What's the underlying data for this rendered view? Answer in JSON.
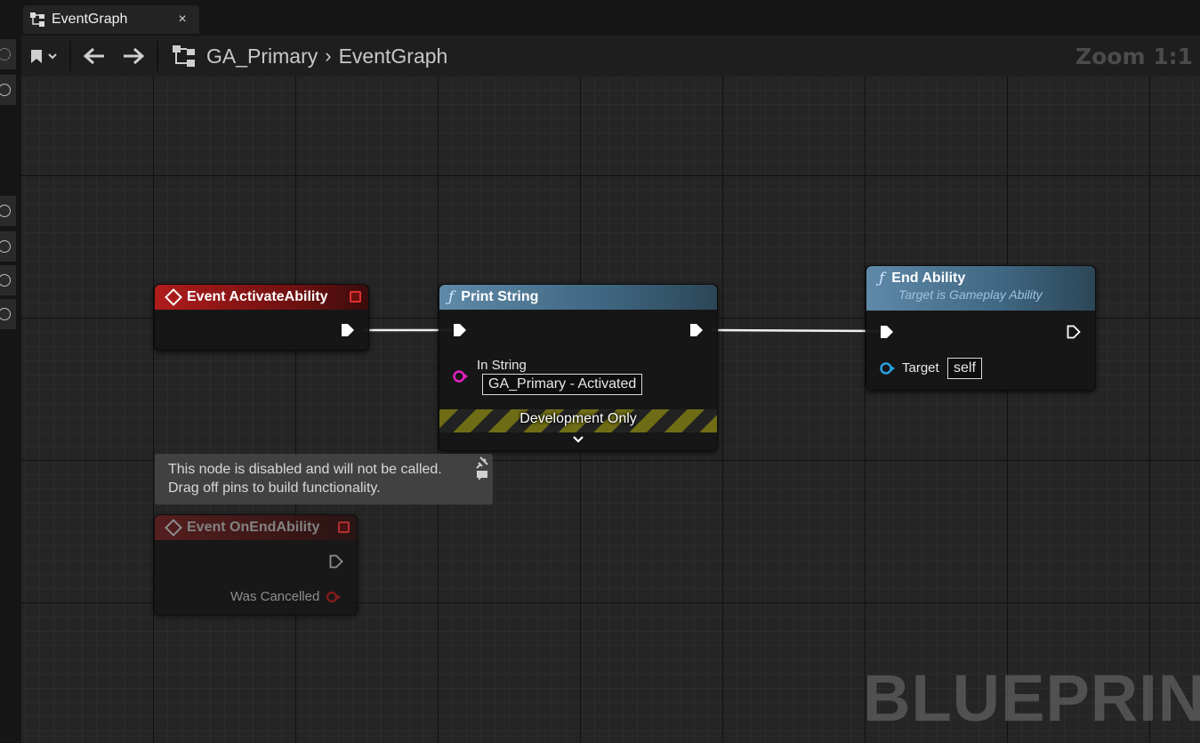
{
  "tab": {
    "label": "EventGraph",
    "close": "×"
  },
  "toolbar": {
    "breadcrumb": [
      "GA_Primary",
      "EventGraph"
    ],
    "breadcrumb_separator": "›",
    "zoom": "Zoom 1:1"
  },
  "nodes": {
    "activate": {
      "title": "Event ActivateAbility"
    },
    "print": {
      "title": "Print String",
      "pin_label": "In String",
      "value": "GA_Primary - Activated",
      "dev_label": "Development Only"
    },
    "end": {
      "title": "End Ability",
      "subtitle": "Target is Gameplay Ability",
      "pin_label": "Target",
      "value": "self"
    },
    "onend": {
      "title": "Event OnEndAbility",
      "pin_label": "Was Cancelled"
    }
  },
  "comment": {
    "line1": "This node is disabled and will not be called.",
    "line2": "Drag off pins to build functionality."
  },
  "watermark": "BLUEPRINT",
  "colors": {
    "event_header": "#b01c1c",
    "function_header": "#5e8aa8",
    "string_pin": "#e020c0",
    "object_pin": "#28a0e0",
    "bool_pin": "#8a1a1a",
    "dev_stripe": "#6e6d15"
  }
}
